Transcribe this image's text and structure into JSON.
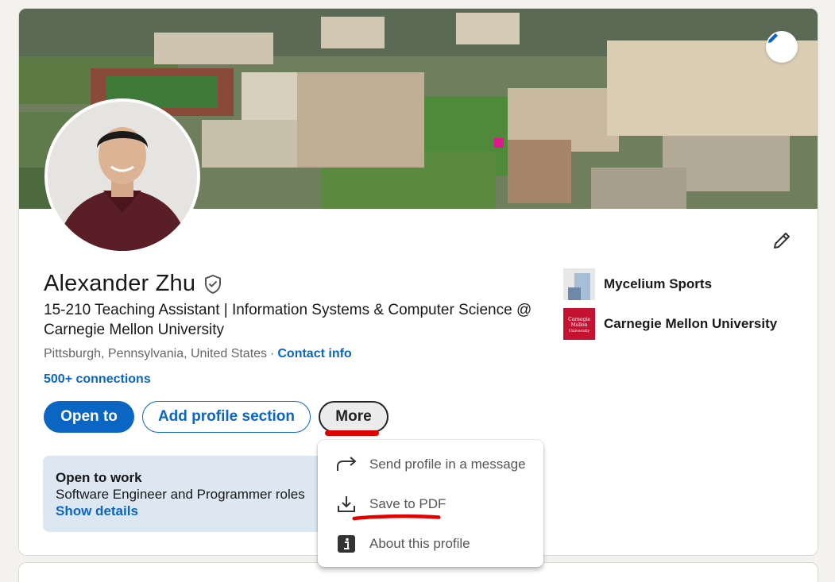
{
  "profile": {
    "name": "Alexander Zhu",
    "headline": "15-210 Teaching Assistant | Information Systems & Computer Science @ Carnegie Mellon University",
    "location": "Pittsburgh, Pennsylvania, United States",
    "separator": "·",
    "contact_info": "Contact info",
    "connections": "500+ connections"
  },
  "actions": {
    "open_to": "Open to",
    "add_section": "Add profile section",
    "more": "More"
  },
  "open_to_work": {
    "title": "Open to work",
    "roles": "Software Engineer and Programmer roles",
    "link": "Show details"
  },
  "experience": [
    {
      "name": "Mycelium Sports",
      "icon": "mycelium-logo"
    },
    {
      "name": "Carnegie Mellon University",
      "icon": "cmu-logo",
      "logo_text": "Carnegie Mellon University"
    }
  ],
  "more_menu": {
    "items": [
      {
        "label": "Send profile in a message",
        "icon": "share-arrow-icon"
      },
      {
        "label": "Save to PDF",
        "icon": "download-icon"
      },
      {
        "label": "About this profile",
        "icon": "info-icon"
      }
    ]
  },
  "colors": {
    "accent": "#0a66c2",
    "annotation": "#e00000",
    "open_to_work_bg": "#dde7f1",
    "cmu_red": "#c41230"
  }
}
